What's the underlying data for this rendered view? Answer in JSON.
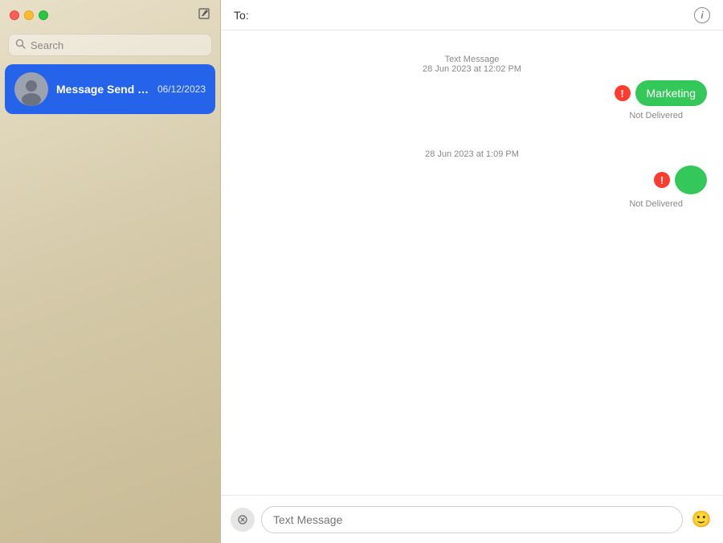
{
  "sidebar": {
    "search_placeholder": "Search",
    "conversations": [
      {
        "id": "conv-1",
        "name": "Message Send Failure",
        "date": "06/12/2023",
        "selected": true
      }
    ]
  },
  "header": {
    "to_label": "To:",
    "info_icon_label": "i"
  },
  "messages": {
    "groups": [
      {
        "timestamp": "Text Message",
        "date": "28 Jun 2023 at 12:02 PM",
        "items": [
          {
            "text": "Marketing",
            "type": "bubble",
            "status": "Not Delivered",
            "has_error": true
          }
        ]
      },
      {
        "timestamp": "",
        "date": "28 Jun 2023 at 1:09 PM",
        "items": [
          {
            "text": "",
            "type": "dot",
            "status": "Not Delivered",
            "has_error": true
          }
        ]
      }
    ]
  },
  "input": {
    "placeholder": "Text Message",
    "apps_icon": "A",
    "emoji_icon": "🙂"
  },
  "icons": {
    "compose": "✏",
    "search": "🔍",
    "info": "i",
    "error": "!"
  },
  "colors": {
    "bubble_green": "#34c759",
    "error_red": "#ff3b30",
    "selected_blue": "#2563eb"
  }
}
